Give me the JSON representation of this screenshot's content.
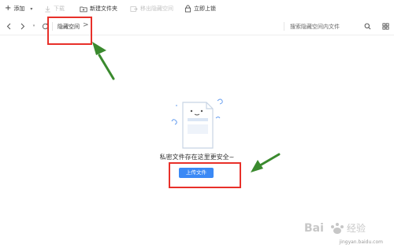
{
  "toolbar": {
    "add_label": "添加",
    "download_label": "下载",
    "new_folder_label": "新建文件夹",
    "move_out_label": "移出隐藏空间",
    "lock_label": "立即上锁"
  },
  "nav": {
    "breadcrumb": "隐藏空间",
    "breadcrumb_arrow": ">",
    "search_placeholder": "搜索隐藏空间内文件"
  },
  "empty_state": {
    "message": "私密文件存在这里更安全~",
    "upload_label": "上传文件"
  },
  "watermark": {
    "logo_text": "Bai 经验",
    "url_text": "jingyan.baidu.com"
  },
  "colors": {
    "accent": "#3b89f5",
    "annotation_box": "#e8302a",
    "annotation_arrow": "#3a8a2e"
  }
}
